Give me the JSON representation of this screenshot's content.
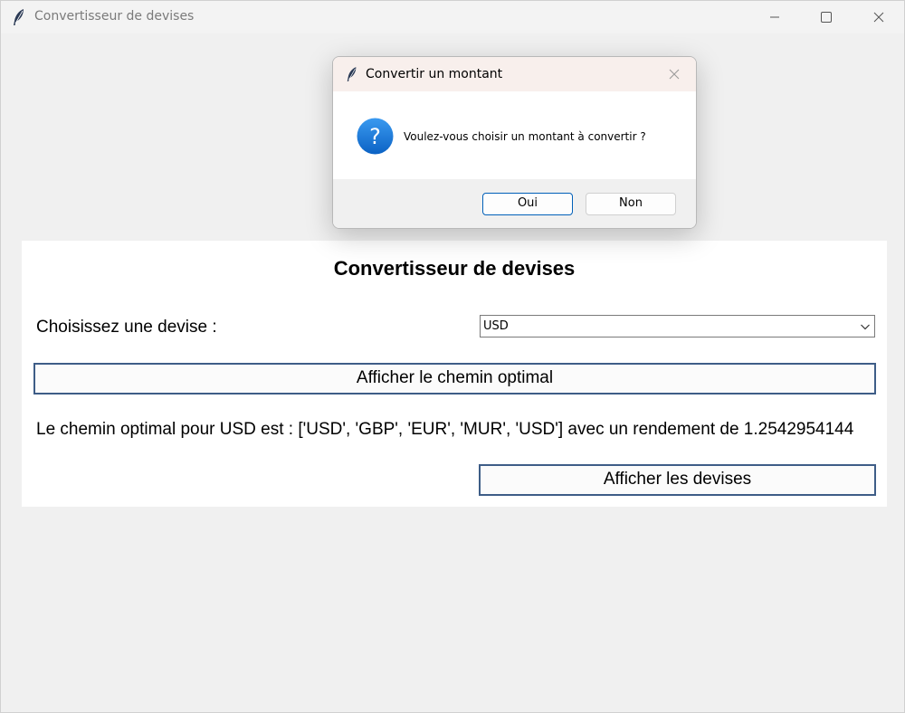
{
  "window": {
    "title": "Convertisseur de devises",
    "icon": "feather-icon",
    "controls": [
      "minimize-icon",
      "maximize-icon",
      "close-icon"
    ]
  },
  "main": {
    "heading": "Convertisseur de devises",
    "choose_label": "Choisissez une devise :",
    "currency_select": {
      "value": "USD"
    },
    "show_path_button": "Afficher le chemin optimal",
    "result_text": "Le chemin optimal pour USD est : ['USD', 'GBP', 'EUR', 'MUR', 'USD'] avec un rendement de 1.2542954144",
    "show_currencies_button": "Afficher les devises"
  },
  "dialog": {
    "title": "Convertir un montant",
    "icon": "question-icon",
    "message": "Voulez-vous choisir un montant à convertir ?",
    "yes_label": "Oui",
    "no_label": "Non"
  },
  "colors": {
    "accent": "#005fb8",
    "tk_button_border": "#3e5d87",
    "question_icon": "#1e7fd6"
  }
}
